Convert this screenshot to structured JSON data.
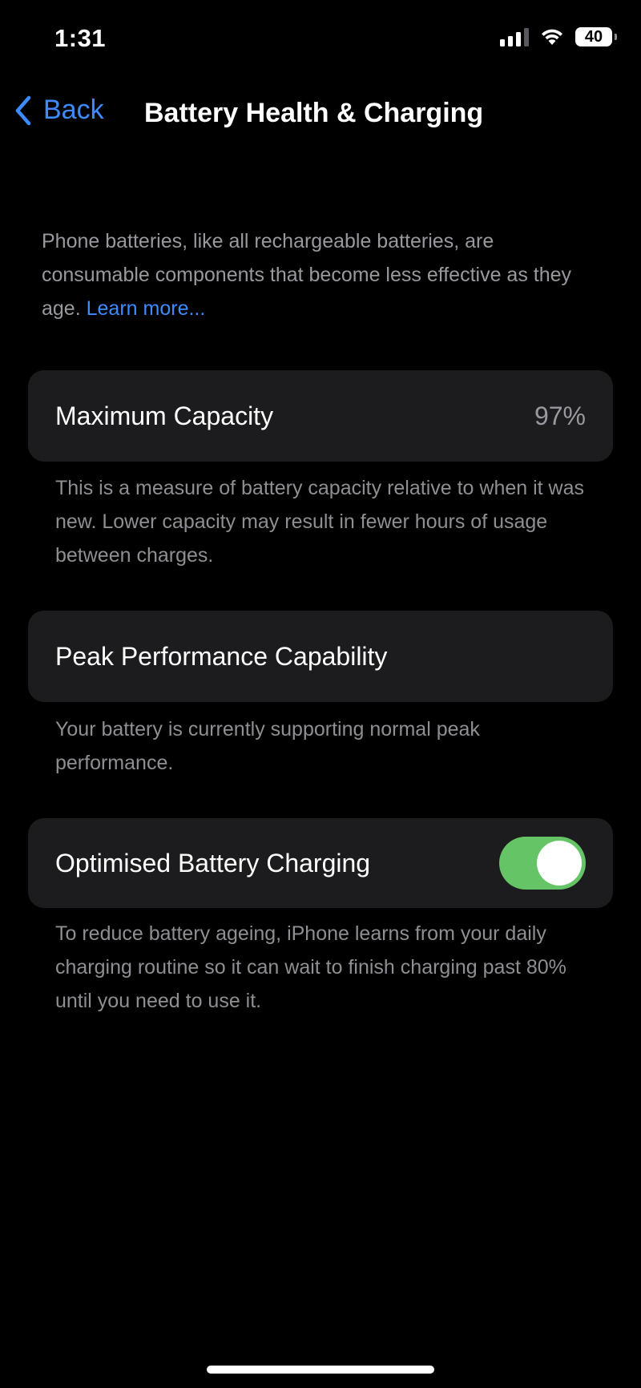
{
  "status_bar": {
    "time": "1:31",
    "battery_level": "40",
    "signal_icon": "cellular-signal-icon",
    "wifi_icon": "wifi-icon"
  },
  "nav": {
    "back_label": "Back",
    "title": "Battery Health & Charging"
  },
  "intro": {
    "text": "Phone batteries, like all rechargeable batteries, are consumable components that become less effective as they age.",
    "link_label": "Learn more..."
  },
  "maximum_capacity": {
    "label": "Maximum Capacity",
    "value": "97%",
    "footer": "This is a measure of battery capacity relative to when it was new. Lower capacity may result in fewer hours of usage between charges."
  },
  "peak_performance": {
    "label": "Peak Performance Capability",
    "footer": "Your battery is currently supporting normal peak performance."
  },
  "optimised_charging": {
    "label": "Optimised Battery Charging",
    "enabled": true,
    "footer": "To reduce battery ageing, iPhone learns from your daily charging routine so it can wait to finish charging past 80% until you need to use it."
  },
  "colors": {
    "accent": "#3d8bff",
    "toggle_on": "#65c466",
    "card_bg": "#1c1c1e",
    "secondary_text": "#98989f"
  }
}
